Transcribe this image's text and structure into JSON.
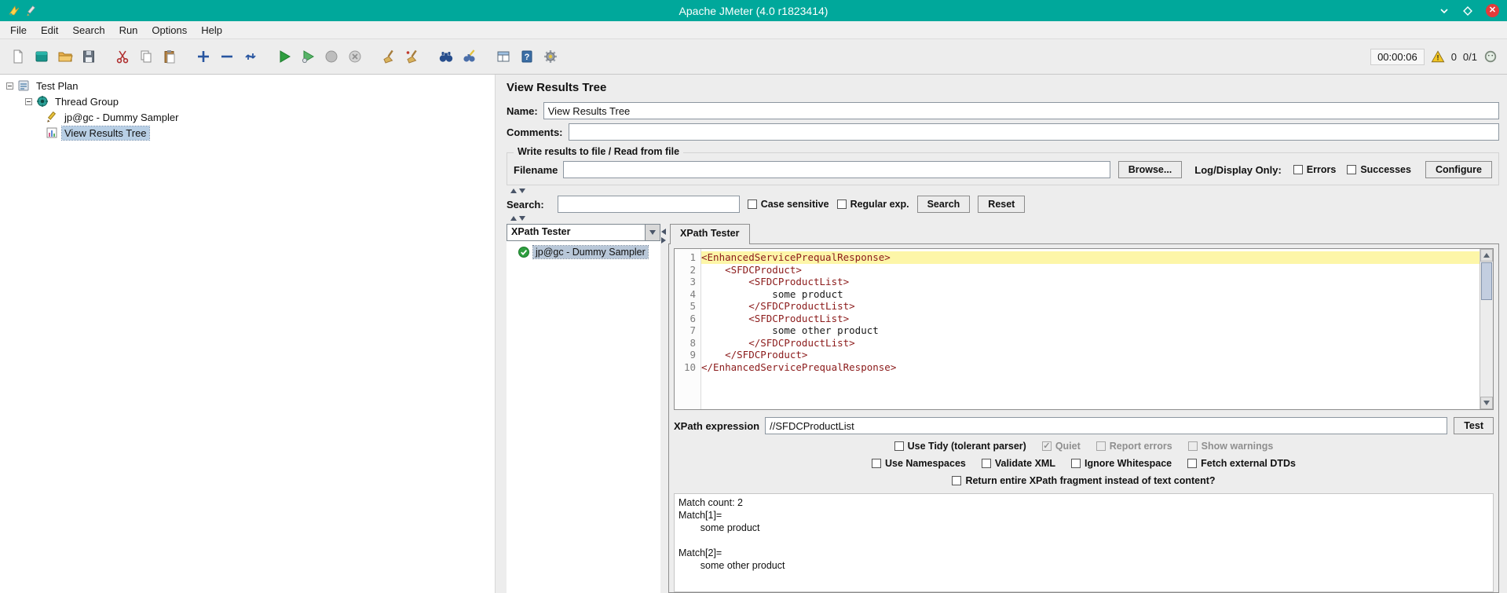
{
  "window": {
    "title": "Apache JMeter (4.0 r1823414)"
  },
  "menu": {
    "items": [
      "File",
      "Edit",
      "Search",
      "Run",
      "Options",
      "Help"
    ]
  },
  "toolbar": {
    "timer": "00:00:06",
    "error_count": "0",
    "threads": "0/1"
  },
  "tree": {
    "items": [
      {
        "label": "Test Plan"
      },
      {
        "label": "Thread Group"
      },
      {
        "label": "jp@gc - Dummy Sampler"
      },
      {
        "label": "View Results Tree"
      }
    ]
  },
  "main": {
    "title": "View Results Tree",
    "name_label": "Name:",
    "name_value": "View Results Tree",
    "comments_label": "Comments:",
    "comments_value": "",
    "file_section": {
      "title": "Write results to file / Read from file",
      "filename_label": "Filename",
      "filename_value": "",
      "browse_button": "Browse...",
      "log_display_label": "Log/Display Only:",
      "errors_checkbox": "Errors",
      "successes_checkbox": "Successes",
      "configure_button": "Configure"
    },
    "search_bar": {
      "label": "Search:",
      "value": "",
      "case_sensitive": "Case sensitive",
      "regular_exp": "Regular exp.",
      "search_button": "Search",
      "reset_button": "Reset"
    },
    "results_pane": {
      "renderer_combo": "XPath Tester",
      "result_item": "jp@gc - Dummy Sampler",
      "tab": "XPath Tester"
    },
    "xpath_tester": {
      "code_lines": [
        {
          "num": "1",
          "text": "<EnhancedServicePrequalResponse>"
        },
        {
          "num": "2",
          "text": "    <SFDCProduct>"
        },
        {
          "num": "3",
          "text": "        <SFDCProductList>"
        },
        {
          "num": "4",
          "text": "            some product"
        },
        {
          "num": "5",
          "text": "        </SFDCProductList>"
        },
        {
          "num": "6",
          "text": "        <SFDCProductList>"
        },
        {
          "num": "7",
          "text": "            some other product"
        },
        {
          "num": "8",
          "text": "        </SFDCProductList>"
        },
        {
          "num": "9",
          "text": "    </SFDCProduct>"
        },
        {
          "num": "10",
          "text": "</EnhancedServicePrequalResponse>"
        }
      ],
      "expression_label": "XPath expression",
      "expression_value": "//SFDCProductList",
      "test_button": "Test",
      "options_row1": [
        "Use Tidy (tolerant parser)",
        "Quiet",
        "Report errors",
        "Show warnings"
      ],
      "options_row2": [
        "Use Namespaces",
        "Validate XML",
        "Ignore Whitespace",
        "Fetch external DTDs"
      ],
      "options_row3": "Return entire XPath fragment instead of text content?",
      "match_lines": [
        "Match count: 2",
        "Match[1]=",
        "        some product",
        "",
        "Match[2]=",
        "        some other product"
      ]
    }
  },
  "colors": {
    "titlebar": "#00a89b",
    "selection": "#b8cfe5",
    "line_highlight": "#fdf6a8",
    "xml_tag": "#8b1a1a",
    "success_green": "#2e9e3f"
  }
}
